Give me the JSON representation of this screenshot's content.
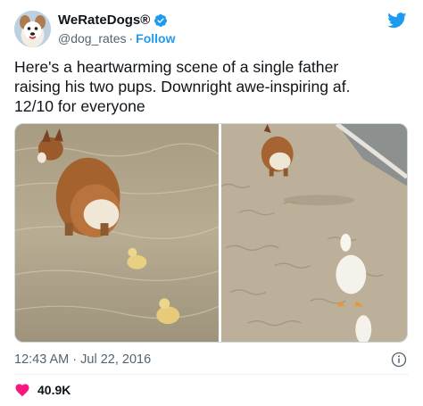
{
  "account": {
    "name": "WeRateDogs®",
    "handle": "@dog_rates",
    "separator": "·",
    "follow_label": "Follow",
    "avatar_icon": "dog-avatar",
    "verified_icon": "verified-badge-icon"
  },
  "platform_icon": "twitter-bird-icon",
  "tweet": {
    "lines": [
      "Here's a heartwarming scene of a single father",
      "raising his two pups. Downright awe-inspiring af.",
      "12/10 for everyone"
    ]
  },
  "media": {
    "photos": [
      {
        "subject": "corgi-and-ducklings-in-water"
      },
      {
        "subject": "corgi-and-ducks-on-beach"
      }
    ]
  },
  "meta": {
    "timestamp": "12:43 AM · Jul 22, 2016",
    "info_icon": "info-icon"
  },
  "engagement": {
    "like_icon": "heart-icon",
    "like_count": "40.9K"
  },
  "colors": {
    "accent": "#1d9bf0",
    "heart": "#f91880",
    "text": "#0f1419",
    "secondary_text": "#536471"
  }
}
